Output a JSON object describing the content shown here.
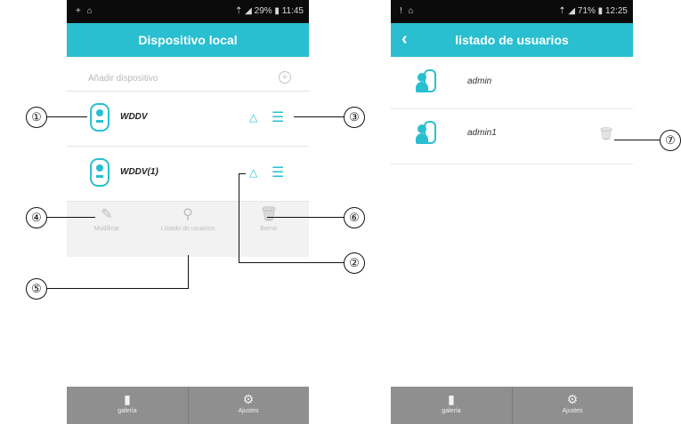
{
  "left_phone": {
    "status": {
      "left": "+ ⌂",
      "right": "⇡ ◢ 29% ▮ 11:45"
    },
    "title": "Dispositivo local",
    "add_device": "Añadir dispositivo",
    "devices": [
      {
        "name": "WDDV"
      },
      {
        "name": "WDDV(1)"
      }
    ],
    "actions": [
      {
        "label": "Modificar",
        "icon": "edit-icon"
      },
      {
        "label": "Listado de usuarios",
        "icon": "user-list-icon"
      },
      {
        "label": "Borrar",
        "icon": "trash-icon"
      }
    ],
    "tabs": [
      {
        "label": "galería",
        "icon": "gallery-icon"
      },
      {
        "label": "Ajustes",
        "icon": "settings-icon"
      }
    ]
  },
  "right_phone": {
    "status": {
      "left": "! ⌂",
      "right": "⇡ ◢ 71% ▮ 12:25"
    },
    "title": "listado de usuarios",
    "users": [
      {
        "name": "admin"
      },
      {
        "name": "admin1"
      }
    ],
    "tabs": [
      {
        "label": "galería",
        "icon": "gallery-icon"
      },
      {
        "label": "Ajustes",
        "icon": "settings-icon"
      }
    ]
  },
  "callouts": [
    "①",
    "②",
    "③",
    "④",
    "⑤",
    "⑥",
    "⑦"
  ]
}
